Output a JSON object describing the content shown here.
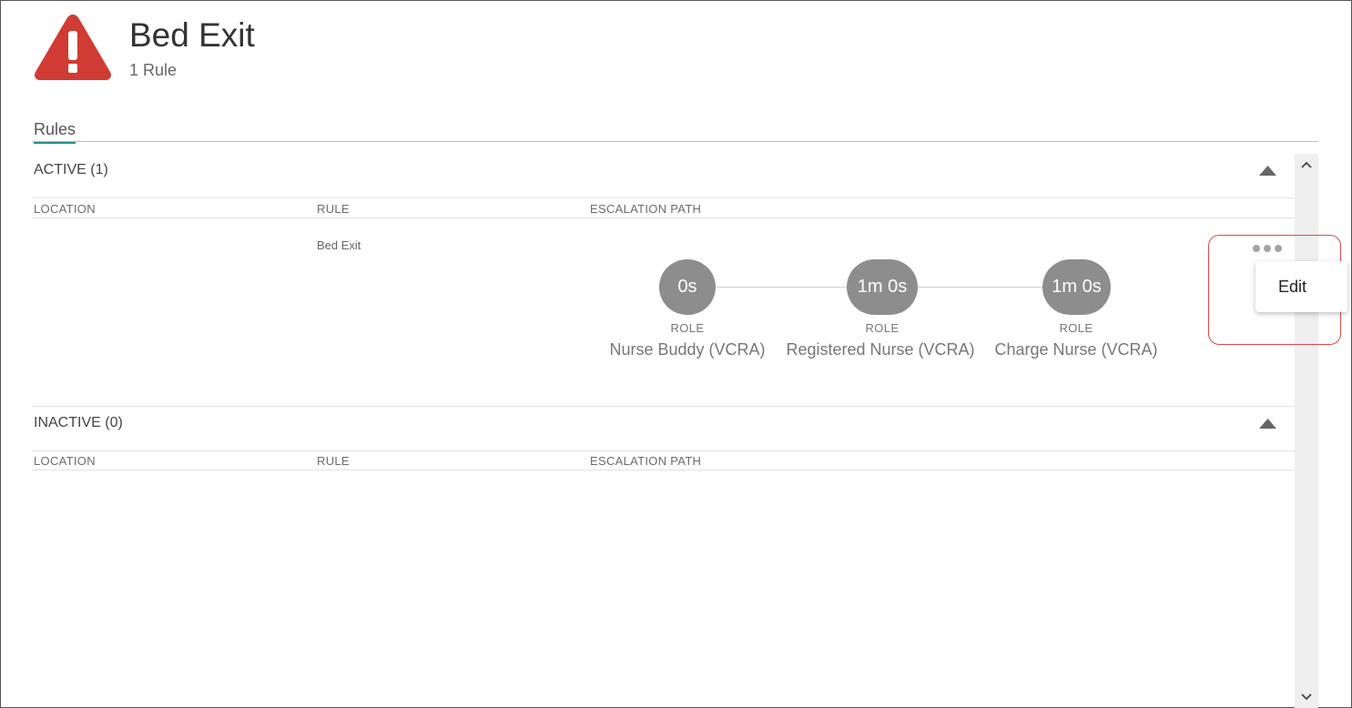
{
  "header": {
    "title": "Bed Exit",
    "subtitle": "1 Rule",
    "icon": "warning-triangle-icon",
    "icon_color": "#d03b33"
  },
  "tabs": [
    {
      "label": "Rules",
      "active": true
    }
  ],
  "tab_accent_color": "#2e8a86",
  "active_section": {
    "title": "ACTIVE (1)",
    "columns": [
      "LOCATION",
      "RULE",
      "ESCALATION PATH"
    ],
    "rows": [
      {
        "location": "",
        "rule": "Bed Exit",
        "escalation_path": [
          {
            "delay": "0s",
            "type": "ROLE",
            "name": "Nurse Buddy (VCRA)"
          },
          {
            "delay": "1m 0s",
            "type": "ROLE",
            "name": "Registered Nurse (VCRA)"
          },
          {
            "delay": "1m 0s",
            "type": "ROLE",
            "name": "Charge Nurse (VCRA)"
          }
        ]
      }
    ]
  },
  "inactive_section": {
    "title": "INACTIVE (0)",
    "columns": [
      "LOCATION",
      "RULE",
      "ESCALATION PATH"
    ],
    "rows": []
  },
  "context_menu": {
    "trigger_icon": "more-horizontal-icon",
    "items": [
      {
        "label": "Edit"
      }
    ]
  },
  "highlight_color": "#e0474a"
}
